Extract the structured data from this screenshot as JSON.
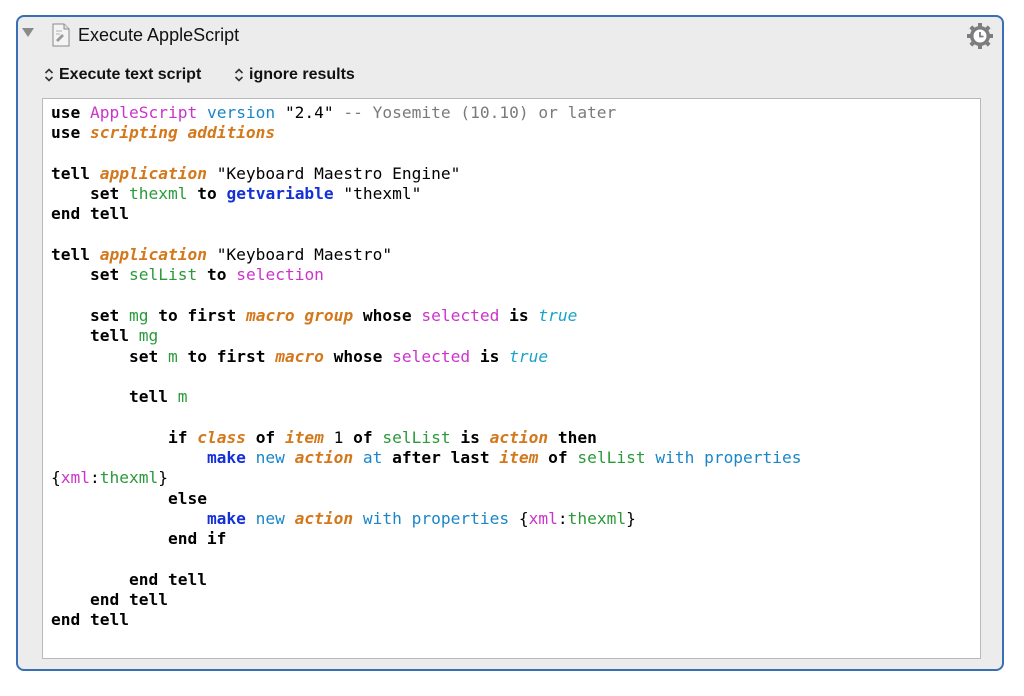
{
  "action": {
    "title": "Execute AppleScript",
    "icon": "script-icon",
    "settings_icon": "gear-clock-icon",
    "disclosure_icon": "disclosure-triangle-icon"
  },
  "options": {
    "execute_mode": "Execute text script",
    "result_mode": "ignore results"
  },
  "editor": {
    "line_count": 26,
    "script": {
      "l1": {
        "k1": "use",
        "a": "AppleScript",
        "b": "version",
        "s": "\"2.4\"",
        "c": "-- Yosemite (10.10) or later"
      },
      "l2": {
        "k1": "use",
        "o": "scripting additions"
      },
      "l4": {
        "k1": "tell",
        "o": "application",
        "s": "\"Keyboard Maestro Engine\""
      },
      "l5": {
        "k1": "set",
        "g": "thexml",
        "k2": "to",
        "bb": "getvariable",
        "s": "\"thexml\""
      },
      "l6": {
        "k1": "end tell"
      },
      "l8": {
        "k1": "tell",
        "o": "application",
        "s": "\"Keyboard Maestro\""
      },
      "l9": {
        "k1": "set",
        "g": "selList",
        "k2": "to",
        "p": "selection"
      },
      "l11": {
        "k1": "set",
        "g": "mg",
        "k2": "to first",
        "o": "macro group",
        "k3": "whose",
        "p": "selected",
        "k4": "is",
        "t": "true"
      },
      "l12": {
        "k1": "tell",
        "g": "mg"
      },
      "l13": {
        "k1": "set",
        "g": "m",
        "k2": "to first",
        "o": "macro",
        "k3": "whose",
        "p": "selected",
        "k4": "is",
        "t": "true"
      },
      "l15": {
        "k1": "tell",
        "g": "m"
      },
      "l17": {
        "k1": "if",
        "o1": "class",
        "k2": "of",
        "o2": "item",
        "n": "1",
        "k3": "of",
        "g": "selList",
        "k4": "is",
        "o3": "action",
        "k5": "then"
      },
      "l18": {
        "bb": "make",
        "b1": "new",
        "o1": "action",
        "b2": "at",
        "k1": "after last",
        "o2": "item",
        "k2": "of",
        "g": "selList",
        "b3": "with properties"
      },
      "l19": {
        "o": "{",
        "p": "xml",
        "sep": ":",
        "g": "thexml",
        "c": "}"
      },
      "l20": {
        "k1": "else"
      },
      "l21": {
        "bb": "make",
        "b1": "new",
        "o1": "action",
        "b2": "with properties",
        "o": "{",
        "p": "xml",
        "sep": ":",
        "g": "thexml",
        "c": "}"
      },
      "l22": {
        "k1": "end if"
      },
      "l24": {
        "k1": "end tell"
      },
      "l25": {
        "k1": "end tell"
      },
      "l26": {
        "k1": "end tell"
      }
    }
  },
  "colors": {
    "panel_border": "#3a6eb5",
    "keyword": "#000000",
    "app_class": "#cc33cc",
    "property": "#1a86c8",
    "term_italic": "#d4781c",
    "variable": "#2a9a3a",
    "comment": "#7a7a7a",
    "command": "#1431d8",
    "boolean": "#1aa3c8"
  }
}
